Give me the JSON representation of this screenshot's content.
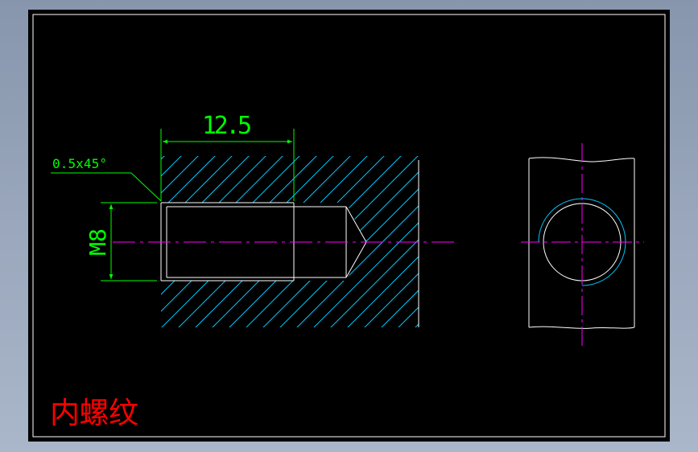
{
  "drawing": {
    "dimension_length": "12.5",
    "chamfer_label": "0.5x45°",
    "thread_label": "M8",
    "title": "内螺纹"
  },
  "colors": {
    "background": "#000000",
    "dimension": "#00ff00",
    "hatch": "#00c8ff",
    "outline": "#ffffff",
    "centerline": "#ff00ff",
    "title": "#ff0000"
  }
}
